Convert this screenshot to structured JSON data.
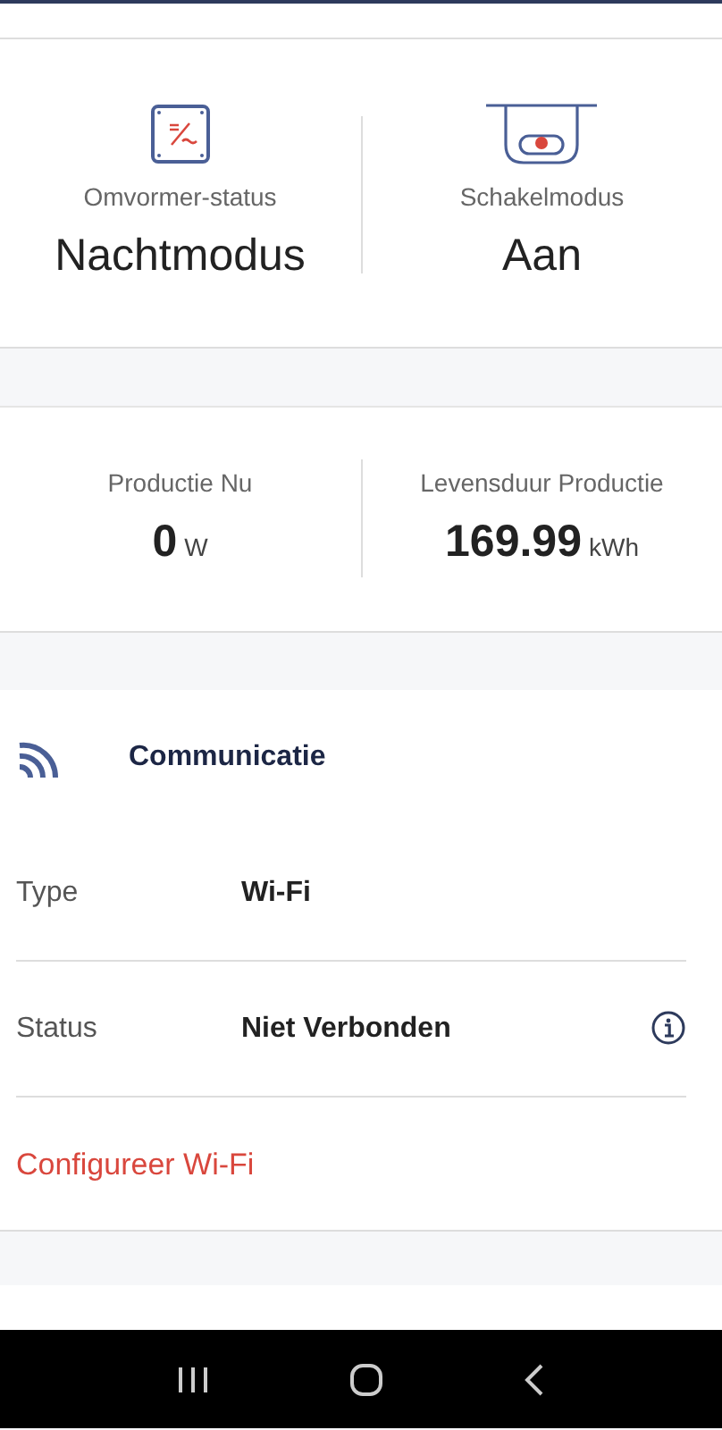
{
  "status_cards": [
    {
      "label": "Omvormer-status",
      "value": "Nachtmodus"
    },
    {
      "label": "Schakelmodus",
      "value": "Aan"
    }
  ],
  "production": [
    {
      "label": "Productie Nu",
      "value": "0",
      "unit": "W"
    },
    {
      "label": "Levensduur Productie",
      "value": "169.99",
      "unit": "kWh"
    }
  ],
  "communication": {
    "title": "Communicatie",
    "rows": [
      {
        "label": "Type",
        "value": "Wi-Fi",
        "info": false
      },
      {
        "label": "Status",
        "value": "Niet Verbonden",
        "info": true
      }
    ],
    "link": "Configureer Wi-Fi"
  }
}
